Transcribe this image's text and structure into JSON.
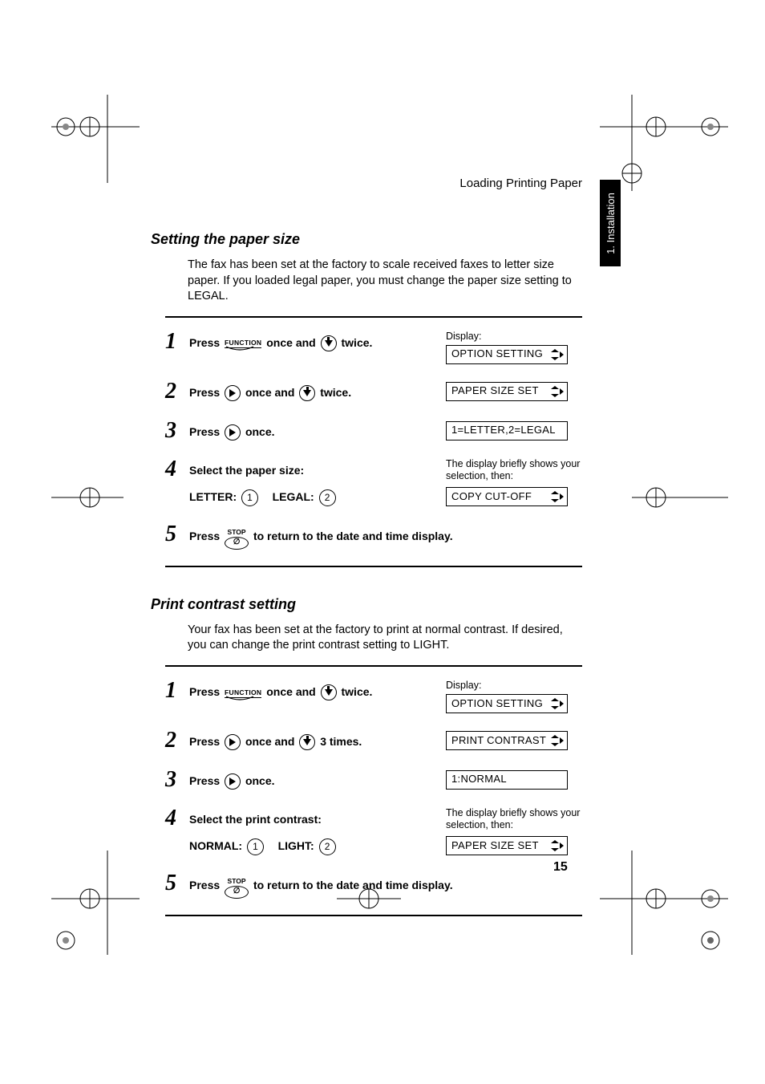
{
  "header": {
    "section": "Loading Printing Paper"
  },
  "tab": {
    "label": "1. Installation"
  },
  "page_number": "15",
  "section1": {
    "title": "Setting the paper size",
    "body": "The fax has been set at the factory to scale received faxes to letter size paper. If you loaded legal paper, you must change the paper size setting to LEGAL.",
    "steps": {
      "s1": {
        "press": "Press",
        "func": "FUNCTION",
        "mid": "once and",
        "tail": "twice.",
        "display_label": "Display:",
        "lcd": "OPTION SETTING"
      },
      "s2": {
        "press": "Press",
        "mid": "once and",
        "tail": "twice.",
        "lcd": "PAPER SIZE SET"
      },
      "s3": {
        "press": "Press",
        "tail": "once.",
        "lcd": "1=LETTER,2=LEGAL"
      },
      "s4": {
        "line1": "Select the paper size:",
        "opt1": "LETTER:",
        "opt1num": "1",
        "opt2": "LEGAL:",
        "opt2num": "2",
        "note": "The display briefly shows your selection, then:",
        "lcd": "COPY CUT-OFF"
      },
      "s5": {
        "press": "Press",
        "stop": "STOP",
        "tail": "to return to the date and time display."
      }
    }
  },
  "section2": {
    "title": "Print contrast setting",
    "body": "Your fax has been set at the factory to print at normal contrast. If desired, you can change the print contrast setting to LIGHT.",
    "steps": {
      "s1": {
        "press": "Press",
        "func": "FUNCTION",
        "mid": "once and",
        "tail": "twice.",
        "display_label": "Display:",
        "lcd": "OPTION SETTING"
      },
      "s2": {
        "press": "Press",
        "mid": "once and",
        "tail": "3 times.",
        "lcd": "PRINT CONTRAST"
      },
      "s3": {
        "press": "Press",
        "tail": "once.",
        "lcd": "1:NORMAL"
      },
      "s4": {
        "line1": "Select the print contrast:",
        "opt1": "NORMAL:",
        "opt1num": "1",
        "opt2": "LIGHT:",
        "opt2num": "2",
        "note": "The display briefly shows your selection, then:",
        "lcd": "PAPER SIZE SET"
      },
      "s5": {
        "press": "Press",
        "stop": "STOP",
        "tail": "to return to the date and time display."
      }
    }
  }
}
